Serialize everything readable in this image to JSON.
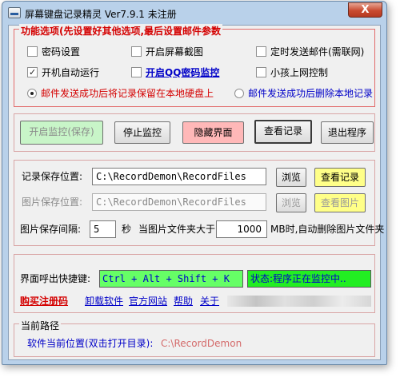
{
  "window": {
    "title": "屏幕键盘记录精灵 Ver7.9.1  未注册",
    "close_glyph": "X"
  },
  "options": {
    "legend": "功能选项(先设置好其他选项,最后设置邮件参数",
    "checkboxes": [
      {
        "label": "密码设置",
        "checked": false
      },
      {
        "label": "开启屏幕截图",
        "checked": false
      },
      {
        "label": "定时发送邮件(需联网)",
        "checked": false
      },
      {
        "label": "开机自动运行",
        "checked": true
      },
      {
        "label": "开启QQ密码监控",
        "checked": false
      },
      {
        "label": "小孩上网控制",
        "checked": false
      }
    ],
    "radios": [
      {
        "label": "邮件发送成功后将记录保留在本地硬盘上",
        "selected": true
      },
      {
        "label": "邮件发送成功后删除本地记录",
        "selected": false
      }
    ]
  },
  "actions": {
    "start": "开启监控(保存)",
    "stop": "停止监控",
    "hide": "隐藏界面",
    "view": "查看记录",
    "exit": "退出程序"
  },
  "save": {
    "record_label": "记录保存位置:",
    "record_path": "C:\\RecordDemon\\RecordFiles",
    "browse1": "浏览",
    "view_records": "查看记录",
    "image_label": "图片保存位置:",
    "image_path": "C:\\RecordDemon\\RecordFiles",
    "browse2": "浏览",
    "view_images": "查看图片",
    "interval_label": "图片保存间隔:",
    "interval_value": "5",
    "seconds_label": "秒",
    "folder_label": "当图片文件夹大于",
    "folder_size": "1000",
    "delete_label": "MB时,自动删除图片文件夹"
  },
  "hotkey": {
    "label": "界面呼出快捷键:",
    "value": "Ctrl + Alt + Shift + K",
    "status": "状态:程序正在监控中.."
  },
  "links": {
    "buy": "购买注册码",
    "uninstall": "卸载软件",
    "website": "官方网站",
    "help": "帮助",
    "about": "关于"
  },
  "path": {
    "legend": "当前路径",
    "label": "软件当前位置(双击打开目录):",
    "value": "C:\\RecordDemon"
  }
}
